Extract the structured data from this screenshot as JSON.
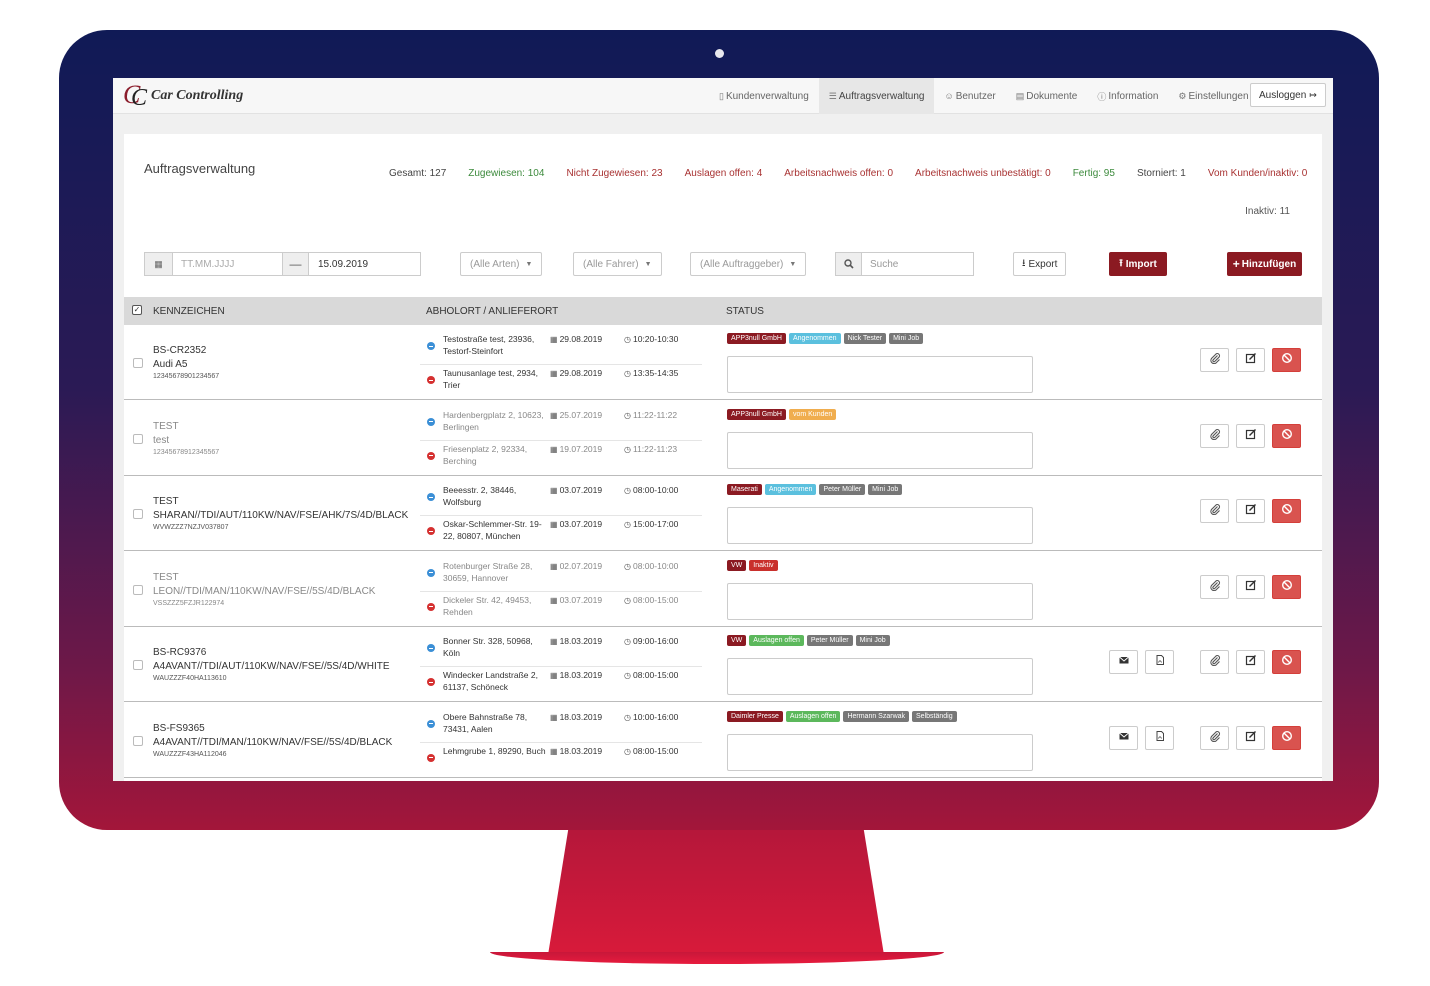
{
  "app": {
    "logo_text": "Car Controlling",
    "logo_mark": "CC",
    "nav": [
      {
        "label": "Kundenverwaltung",
        "icon": "file-icon",
        "active": false
      },
      {
        "label": "Auftragsverwaltung",
        "icon": "list-icon",
        "active": true
      },
      {
        "label": "Benutzer",
        "icon": "users-icon",
        "active": false
      },
      {
        "label": "Dokumente",
        "icon": "document-icon",
        "active": false
      },
      {
        "label": "Information",
        "icon": "info-icon",
        "active": false
      },
      {
        "label": "Einstellungen",
        "icon": "gears-icon",
        "active": false
      }
    ],
    "logout_label": "Ausloggen"
  },
  "page": {
    "title": "Auftragsverwaltung",
    "stats": [
      {
        "label": "Gesamt: 127",
        "color": "grey"
      },
      {
        "label": "Zugewiesen: 104",
        "color": "green"
      },
      {
        "label": "Nicht Zugewiesen: 23",
        "color": "red"
      },
      {
        "label": "Auslagen offen: 4",
        "color": "red"
      },
      {
        "label": "Arbeitsnachweis offen: 0",
        "color": "red"
      },
      {
        "label": "Arbeitsnachweis unbestätigt: 0",
        "color": "red"
      },
      {
        "label": "Fertig: 95",
        "color": "green"
      },
      {
        "label": "Storniert: 1",
        "color": "grey"
      },
      {
        "label": "Vom Kunden/inaktiv: 0",
        "color": "red"
      }
    ],
    "inactive": "Inaktiv: 11"
  },
  "filters": {
    "date_from_placeholder": "TT.MM.JJJJ",
    "date_to_value": "15.09.2019",
    "type_select": "(Alle Arten)",
    "driver_select": "(Alle Fahrer)",
    "client_select": "(Alle Auftraggeber)",
    "search_placeholder": "Suche",
    "export_label": "Export",
    "import_label": "Import",
    "add_label": "Hinzufügen"
  },
  "table": {
    "headers": {
      "vehicle": "KENNZEICHEN",
      "location": "ABHOLORT / ANLIEFERORT",
      "status": "STATUS"
    },
    "rows": [
      {
        "dim": false,
        "plate": "BS-CR2352",
        "model": "Audi A5",
        "vin": "12345678901234567",
        "pickup": {
          "address": "Testostraße test, 23936, Testorf-Steinfort",
          "date": "29.08.2019",
          "time": "10:20-10:30"
        },
        "dropoff": {
          "address": "Taunusanlage test, 2934, Trier",
          "date": "29.08.2019",
          "time": "13:35-14:35"
        },
        "badges": [
          {
            "text": "APP3null GmbH",
            "style": "dark"
          },
          {
            "text": "Angenommen",
            "style": "info"
          },
          {
            "text": "Nick Tester",
            "style": "grey"
          },
          {
            "text": "Mini Job",
            "style": "grey"
          }
        ],
        "extra_actions": false
      },
      {
        "dim": true,
        "plate": "TEST",
        "model": "test",
        "vin": "12345678912345567",
        "pickup": {
          "address": "Hardenbergplatz 2, 10623, Berlingen",
          "date": "25.07.2019",
          "time": "11:22-11:22"
        },
        "dropoff": {
          "address": "Friesenplatz 2, 92334, Berching",
          "date": "19.07.2019",
          "time": "11:22-11:23"
        },
        "badges": [
          {
            "text": "APP3null GmbH",
            "style": "dark"
          },
          {
            "text": "vom Kunden",
            "style": "warn"
          }
        ],
        "extra_actions": false
      },
      {
        "dim": false,
        "plate": "TEST",
        "model": "SHARAN//TDI/AUT/110KW/NAV/FSE/AHK/7S/4D/BLACK",
        "vin": "WVWZZZ7NZJV037807",
        "pickup": {
          "address": "Beeesstr. 2, 38446, Wolfsburg",
          "date": "03.07.2019",
          "time": "08:00-10:00"
        },
        "dropoff": {
          "address": "Oskar-Schlemmer-Str. 19-22, 80807, München",
          "date": "03.07.2019",
          "time": "15:00-17:00"
        },
        "badges": [
          {
            "text": "Maserati",
            "style": "dark"
          },
          {
            "text": "Angenommen",
            "style": "info"
          },
          {
            "text": "Peter Müller",
            "style": "grey"
          },
          {
            "text": "Mini Job",
            "style": "grey"
          }
        ],
        "extra_actions": false
      },
      {
        "dim": true,
        "plate": "TEST",
        "model": "LEON//TDI/MAN/110KW/NAV/FSE//5S/4D/BLACK",
        "vin": "VSSZZZ5FZJR122974",
        "pickup": {
          "address": "Rotenburger Straße 28, 30659, Hannover",
          "date": "02.07.2019",
          "time": "08:00-10:00"
        },
        "dropoff": {
          "address": "Dickeler Str. 42, 49453, Rehden",
          "date": "03.07.2019",
          "time": "08:00-15:00"
        },
        "badges": [
          {
            "text": "VW",
            "style": "dark"
          },
          {
            "text": "Inaktiv",
            "style": "danger"
          }
        ],
        "extra_actions": false
      },
      {
        "dim": false,
        "plate": "BS-RC9376",
        "model": "A4AVANT//TDI/AUT/110KW/NAV/FSE//5S/4D/WHITE",
        "vin": "WAUZZZF40HA113610",
        "pickup": {
          "address": "Bonner Str. 328, 50968, Köln",
          "date": "18.03.2019",
          "time": "09:00-16:00"
        },
        "dropoff": {
          "address": "Windecker Landstraße 2, 61137, Schöneck",
          "date": "18.03.2019",
          "time": "08:00-15:00"
        },
        "badges": [
          {
            "text": "VW",
            "style": "dark"
          },
          {
            "text": "Auslagen offen",
            "style": "success"
          },
          {
            "text": "Peter Müller",
            "style": "grey"
          },
          {
            "text": "Mini Job",
            "style": "grey"
          }
        ],
        "extra_actions": true
      },
      {
        "dim": false,
        "plate": "BS-FS9365",
        "model": "A4AVANT//TDI/MAN/110KW/NAV/FSE//5S/4D/BLACK",
        "vin": "WAUZZZF43HA112046",
        "pickup": {
          "address": "Obere Bahnstraße 78, 73431, Aalen",
          "date": "18.03.2019",
          "time": "10:00-16:00"
        },
        "dropoff": {
          "address": "Lehmgrube 1, 89290, Buch",
          "date": "18.03.2019",
          "time": "08:00-15:00"
        },
        "badges": [
          {
            "text": "Daimler Presse",
            "style": "dark"
          },
          {
            "text": "Auslagen offen",
            "style": "success"
          },
          {
            "text": "Hermann Szarwak",
            "style": "grey"
          },
          {
            "text": "Selbständig",
            "style": "grey"
          }
        ],
        "extra_actions": true
      }
    ]
  }
}
